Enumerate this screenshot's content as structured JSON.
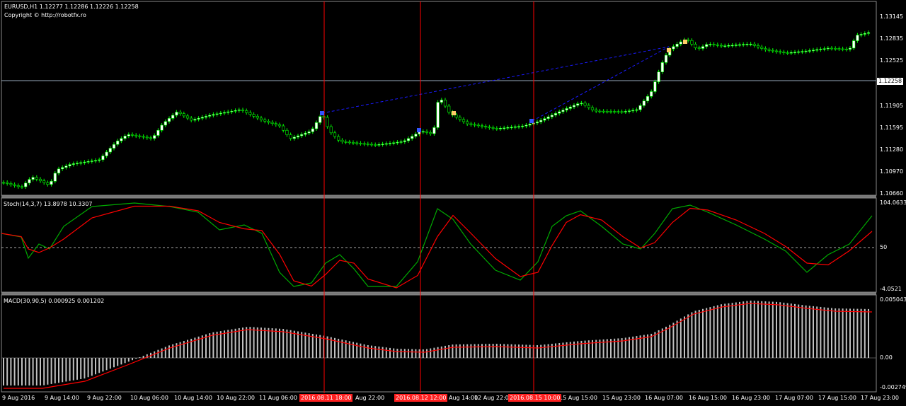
{
  "main_header": {
    "symbol_line": "EURUSD,H1  1.12277 1.12286 1.12226 1.12258",
    "copyright": "Copyright © http://robotfx.ro"
  },
  "price_axis": {
    "ticks": [
      "1.13145",
      "1.12835",
      "1.12525",
      "1.11905",
      "1.11595",
      "1.11280",
      "1.10970",
      "1.10660"
    ],
    "current": "1.12258"
  },
  "stoch": {
    "label": "Stoch(14,3,7) 13.8978 10.3307",
    "ticks": [
      "104.0633",
      "50",
      "-4.0521"
    ]
  },
  "macd": {
    "label": "MACD(30,90,5) 0.000925 0.001202",
    "ticks": [
      "0.005043",
      "0.00",
      "-0.002749"
    ]
  },
  "time_axis": {
    "labels": [
      "9 Aug 2016",
      "9 Aug 14:00",
      "9 Aug 22:00",
      "10 Aug 06:00",
      "10 Aug 14:00",
      "10 Aug 22:00",
      "11 Aug 06:00",
      "Aug 22:00",
      "Aug 14:00",
      "12 Aug 22:00",
      "15 Aug 15:00",
      "15 Aug 23:00",
      "16 Aug 07:00",
      "16 Aug 15:00",
      "16 Aug 23:00",
      "17 Aug 07:00",
      "17 Aug 15:00",
      "17 Aug 23:00"
    ],
    "markers": [
      "2016.08.11 18:00",
      "2016.08.12 12:00",
      "2016.08.15 10:00"
    ]
  },
  "colors": {
    "bull": "#ffffff",
    "bear": "#000000",
    "candle_outline": "#00ff00",
    "vline": "#ff0000",
    "stoch_main": "#00aa00",
    "stoch_signal": "#ff0000",
    "macd_hist": "#c0c0c0",
    "macd_signal": "#ff0000",
    "trendline": "#1a1aff"
  }
}
